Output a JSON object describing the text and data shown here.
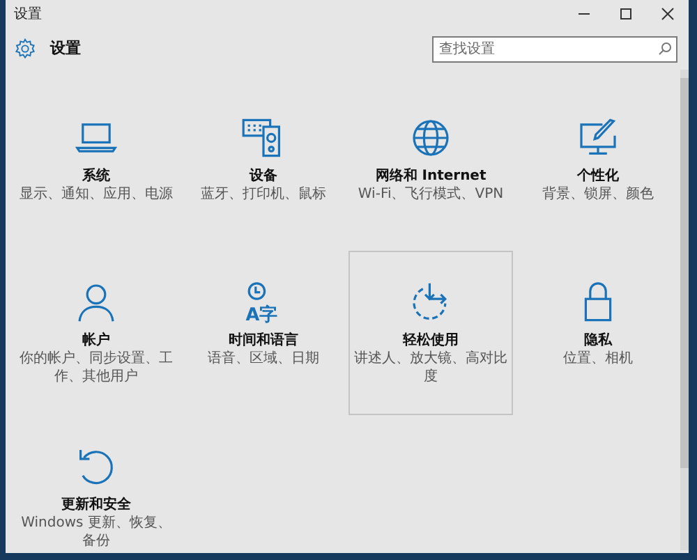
{
  "window": {
    "title": "设置"
  },
  "header": {
    "title": "设置",
    "search": {
      "placeholder": "查找设置"
    }
  },
  "tiles": [
    {
      "label": "系统",
      "description": "显示、通知、应用、电源",
      "hovered": false
    },
    {
      "label": "设备",
      "description": "蓝牙、打印机、鼠标",
      "hovered": false
    },
    {
      "label": "网络和 Internet",
      "description": "Wi-Fi、飞行模式、VPN",
      "hovered": false
    },
    {
      "label": "个性化",
      "description": "背景、锁屏、颜色",
      "hovered": false
    },
    {
      "label": "帐户",
      "description": "你的帐户、同步设置、工作、其他用户",
      "hovered": false
    },
    {
      "label": "时间和语言",
      "description": "语音、区域、日期",
      "hovered": false,
      "icon_text": "A字"
    },
    {
      "label": "轻松使用",
      "description": "讲述人、放大镜、高对比度",
      "hovered": true
    },
    {
      "label": "隐私",
      "description": "位置、相机",
      "hovered": false
    },
    {
      "label": "更新和安全",
      "description": "Windows 更新、恢复、备份",
      "hovered": false
    }
  ]
}
